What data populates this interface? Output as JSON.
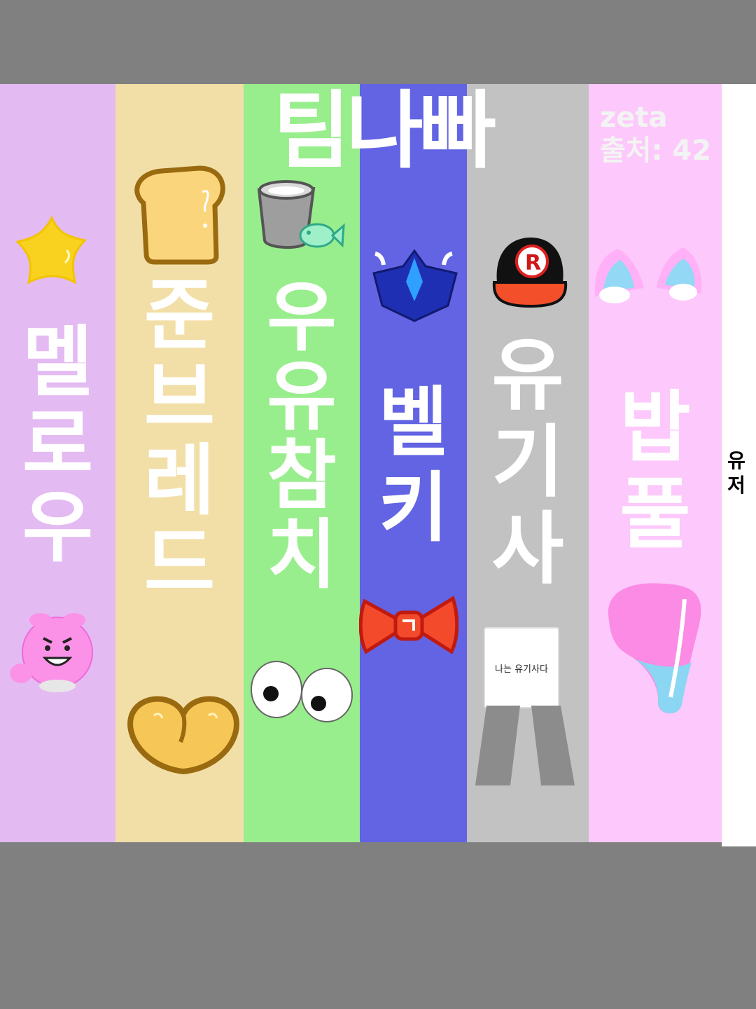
{
  "title": "팀나빠",
  "credit": {
    "user": "zeta",
    "source": "출처: 42"
  },
  "side_label": [
    "유",
    "저"
  ],
  "sign_text": "나는 유기사다",
  "columns": [
    {
      "name": [
        "멜",
        "로",
        "우"
      ],
      "color": "#e4baf2"
    },
    {
      "name": [
        "준",
        "브",
        "레",
        "드"
      ],
      "color": "#f2dfa8"
    },
    {
      "name": [
        "우",
        "유",
        "참",
        "치"
      ],
      "color": "#98ee8c"
    },
    {
      "name": [
        "벨",
        "키"
      ],
      "color": "#6264e3"
    },
    {
      "name": [
        "유",
        "기",
        "사"
      ],
      "color": "#c2c2c2"
    },
    {
      "name": [
        "밥",
        "풀"
      ],
      "color": "#fdc8fb"
    }
  ],
  "icons": [
    "star-icon",
    "toast-icon",
    "milk-cup-icon",
    "fish-icon",
    "blue-gem-wings-icon",
    "red-cap-icon",
    "cat-ears-icon",
    "pink-pig-icon",
    "cookie-icon",
    "googly-eyes-icon",
    "red-bow-icon",
    "pants-icon",
    "pink-paint-icon"
  ]
}
